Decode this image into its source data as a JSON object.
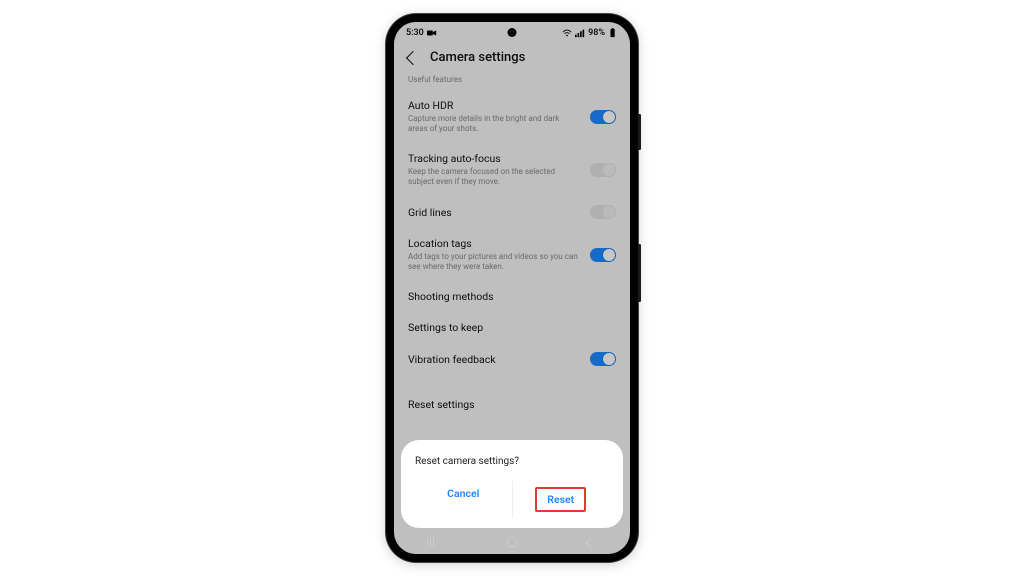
{
  "status": {
    "time": "5:30",
    "battery": "98%"
  },
  "header": {
    "title": "Camera settings"
  },
  "section_label": "Useful features",
  "items": {
    "hdr": {
      "title": "Auto HDR",
      "desc": "Capture more details in the bright and dark areas of your shots.",
      "on": true
    },
    "tracking": {
      "title": "Tracking auto-focus",
      "desc": "Keep the camera focused on the selected subject even if they move.",
      "on": false
    },
    "grid": {
      "title": "Grid lines",
      "on": false
    },
    "location": {
      "title": "Location tags",
      "desc": "Add tags to your pictures and videos so you can see where they were taken.",
      "on": true
    },
    "shooting": {
      "title": "Shooting methods"
    },
    "keep": {
      "title": "Settings to keep"
    },
    "vibration": {
      "title": "Vibration feedback",
      "on": true
    },
    "reset": {
      "title": "Reset settings"
    }
  },
  "dialog": {
    "question": "Reset camera settings?",
    "cancel": "Cancel",
    "confirm": "Reset"
  }
}
